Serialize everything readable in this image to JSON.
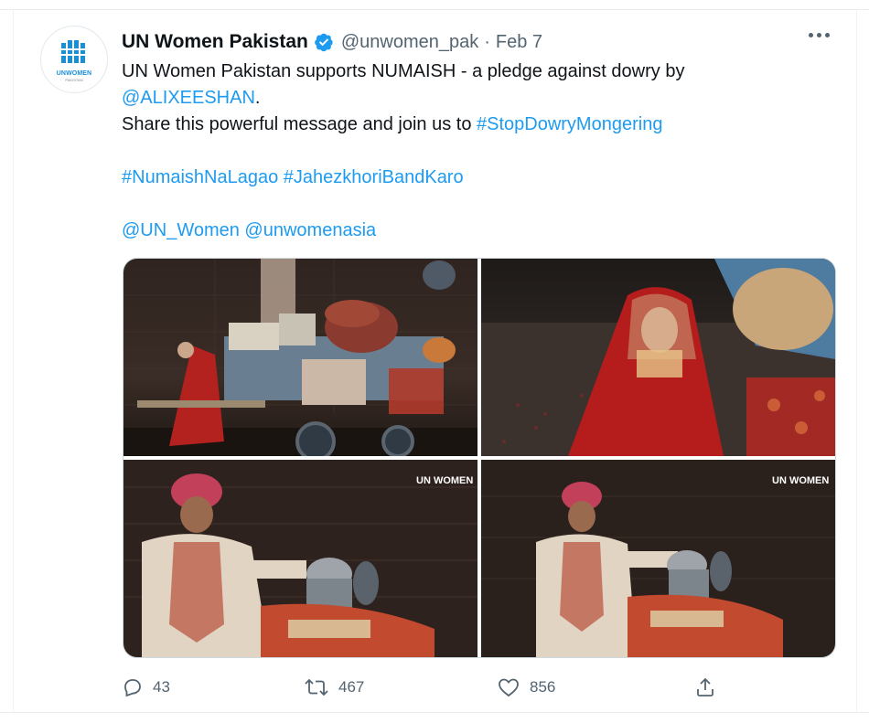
{
  "account": {
    "display_name": "UN Women Pakistan",
    "handle": "@unwomen_pak",
    "separator": "·",
    "date": "Feb 7",
    "avatar_brand": "UNWOMEN",
    "avatar_brand_sub": "PAKISTAN"
  },
  "tweet": {
    "line1": "UN Women Pakistan supports NUMAISH - a pledge against dowry by",
    "mention_author": "@ALIXEESHAN",
    "period": ".",
    "line3_prefix": "Share this powerful message and join us to ",
    "hashtag_stop": "#StopDowryMongering",
    "hashtag_numaish": "#NumaishNaLagao",
    "hashtag_jahez": "#JahezkhoriBandKaro",
    "mention_unwomen": "@UN_Women",
    "mention_unwomenasia": "@unwomenasia"
  },
  "media": {
    "watermark": "UN WOMEN",
    "images": [
      "dowry-cart-photo",
      "bride-portrait-photo",
      "groom-photo-left",
      "groom-photo-right"
    ]
  },
  "actions": {
    "replies": "43",
    "retweets": "467",
    "likes": "856"
  },
  "colors": {
    "link": "#1d9bf0",
    "verified": "#1d9bf0",
    "muted": "#536471"
  }
}
